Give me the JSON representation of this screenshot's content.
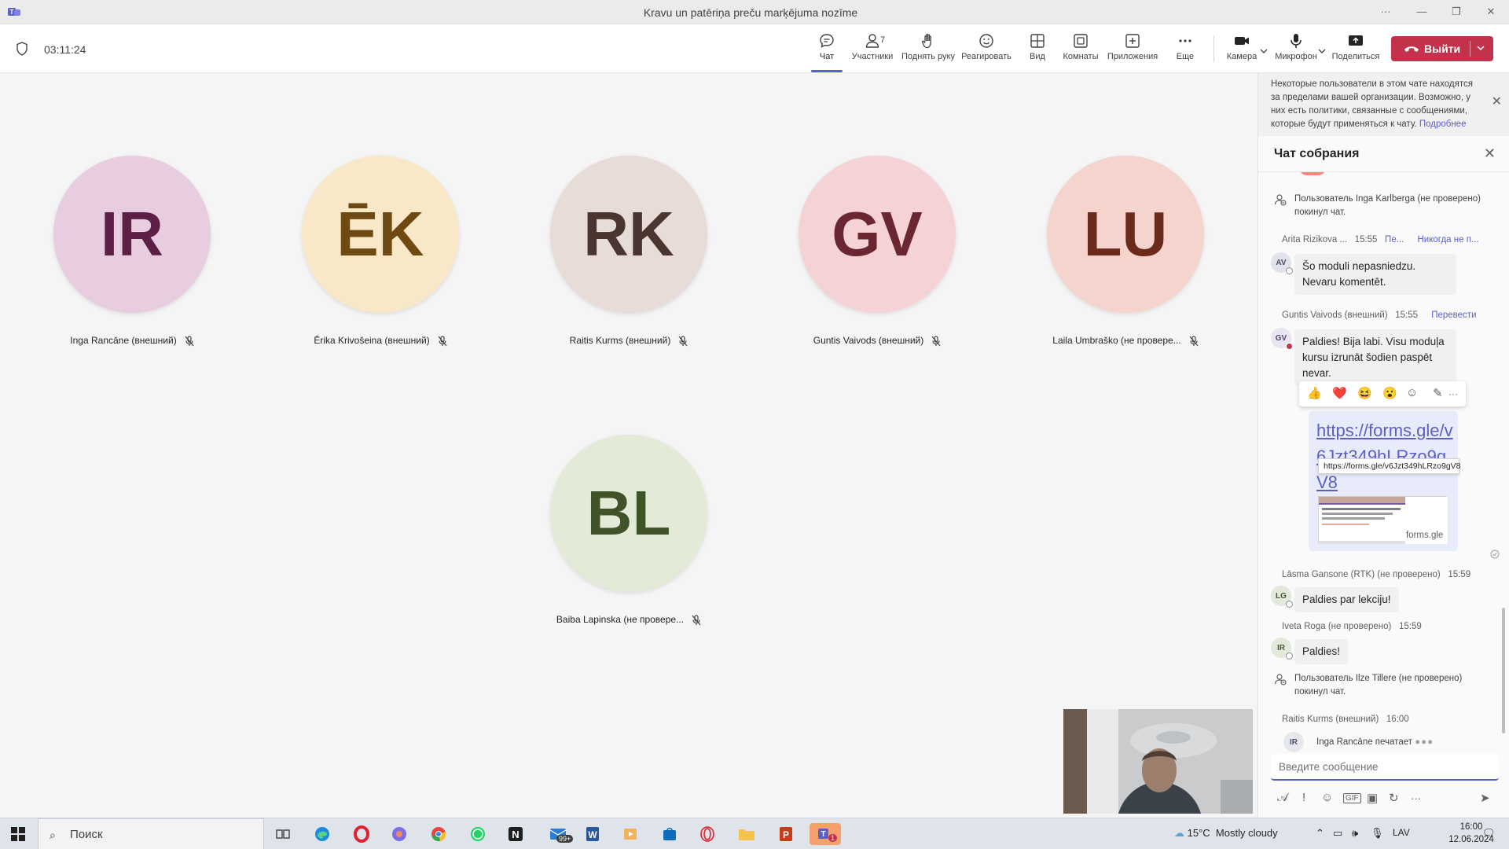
{
  "window": {
    "title": "Kravu un patēriņa preču marķējuma nozīme",
    "controls": {
      "more": "···",
      "minimize": "—",
      "restore": "❐",
      "close": "✕"
    }
  },
  "toolbar": {
    "timer": "03:11:24",
    "buttons": {
      "chat": "Чат",
      "participants": "Участники",
      "participants_count": "7",
      "raise_hand": "Поднять руку",
      "react": "Реагировать",
      "view": "Вид",
      "rooms": "Комнаты",
      "apps": "Приложения",
      "more": "Еще",
      "camera": "Камера",
      "mic": "Микрофон",
      "share": "Поделиться"
    },
    "leave": "Выйти"
  },
  "stage": {
    "participants": [
      {
        "initials": "IR",
        "name": "Inga Rancāne (внешний)",
        "bg": "#e8cde0",
        "fg": "#5c1f45"
      },
      {
        "initials": "ĒK",
        "name": "Ērika Krivošeina (внешний)",
        "bg": "#f8e8c8",
        "fg": "#6e4a12"
      },
      {
        "initials": "RK",
        "name": "Raitis Kurms (внешний)",
        "bg": "#e8dcd8",
        "fg": "#4a3530"
      },
      {
        "initials": "GV",
        "name": "Guntis Vaivods (внешний)",
        "bg": "#f4d2d6",
        "fg": "#6b2731"
      },
      {
        "initials": "LU",
        "name": "Laila Umbraško (не провере...",
        "bg": "#f4d4cc",
        "fg": "#6c2a1d"
      },
      {
        "initials": "BL",
        "name": "Baiba Lapinska (не провере...",
        "bg": "#e4ead8",
        "fg": "#3f5228"
      }
    ]
  },
  "chat": {
    "notice": "Некоторые пользователи в этом чате находятся за пределами вашей организации. Возможно, у них есть политики, связанные с сообщениями, которые будут применяться к чату.",
    "notice_link": "Подробнее",
    "title": "Чат собрания",
    "sys_left_1": "Пользователь Inga Karlberga (не проверено) покинул чат.",
    "msg1": {
      "author": "Arita Rizikova ...",
      "time": "15:55",
      "extra1": "Пе...",
      "extra2": "Никогда не п...",
      "initials": "AV",
      "text": "Šo moduli nepasniedzu. Nevaru komentēt."
    },
    "msg2": {
      "author": "Guntis Vaivods (внешний)",
      "time": "15:55",
      "translate": "Перевести",
      "initials": "GV",
      "text": "Paldies! Bija labi. Visu moduļa kursu izrunāt šodien paspēt nevar."
    },
    "reactions": [
      "👍",
      "❤️",
      "😆",
      "😮",
      "☺",
      "✎",
      "···"
    ],
    "link": {
      "url": "https://forms.gle/v6Jzt349hLRzo9gV8",
      "tooltip": "https://forms.gle/v6Jzt349hLRzo9gV8",
      "domain": "forms.gle"
    },
    "msg3": {
      "author": "Lāsma Gansone (RTK) (не проверено)",
      "time": "15:59",
      "initials": "LG",
      "text": "Paldies par lekciju!"
    },
    "msg4": {
      "author": "Iveta Roga (не проверено)",
      "time": "15:59",
      "initials": "IR",
      "text": "Paldies!"
    },
    "sys_left_2": "Пользователь Ilze Tillere (не проверено) покинул чат.",
    "msg5": {
      "author": "Raitis Kurms (внешний)",
      "time": "16:00",
      "initials": "IR"
    },
    "typing": "Inga Rancāne печатает",
    "compose_placeholder": "Введите сообщение"
  },
  "taskbar": {
    "search": "Поиск",
    "mail_badge": "99+",
    "teams_badge": "1",
    "weather": "15°C",
    "weather_desc": "Mostly cloudy",
    "lang": "LAV",
    "time": "16:00",
    "date": "12.06.2024"
  }
}
